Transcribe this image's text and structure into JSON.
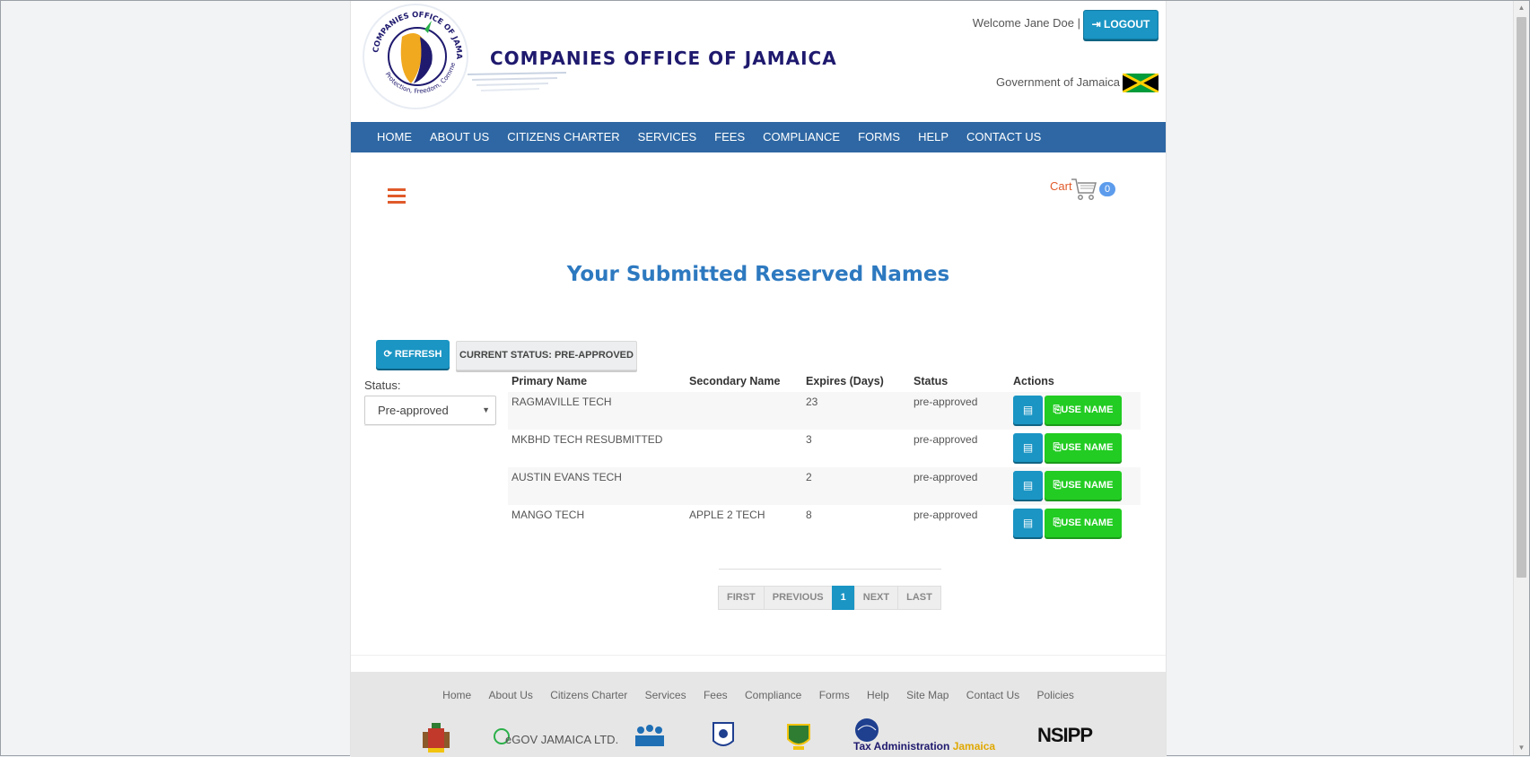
{
  "header": {
    "brand_name": "COMPANIES OFFICE OF JAMAICA",
    "seal_text_top": "COMPANIES OFFICE OF JAMAICA",
    "seal_text_bottom": "Protection, Freedom, Commerce",
    "welcome": "Welcome Jane Doe |",
    "logout_label": "LOGOUT",
    "government_label": "Government of Jamaica"
  },
  "nav": {
    "items": [
      "HOME",
      "ABOUT US",
      "CITIZENS CHARTER",
      "SERVICES",
      "FEES",
      "COMPLIANCE",
      "FORMS",
      "HELP",
      "CONTACT US"
    ]
  },
  "cart": {
    "label": "Cart",
    "count": "0"
  },
  "main": {
    "title": "Your Submitted Reserved Names",
    "refresh_label": "REFRESH",
    "current_status_label": "CURRENT STATUS: PRE-APPROVED",
    "filter_label": "Status:",
    "filter_value": "Pre-approved"
  },
  "table": {
    "headers": [
      "Primary Name",
      "Secondary Name",
      "Expires (Days)",
      "Status",
      "Actions"
    ],
    "rows": [
      {
        "primary": "RAGMAVILLE TECH",
        "secondary": "",
        "expires": "23",
        "status": "pre-approved",
        "use_label": "USE NAME"
      },
      {
        "primary": "MKBHD TECH RESUBMITTED",
        "secondary": "",
        "expires": "3",
        "status": "pre-approved",
        "use_label": "USE NAME"
      },
      {
        "primary": "AUSTIN EVANS TECH",
        "secondary": "",
        "expires": "2",
        "status": "pre-approved",
        "use_label": "USE NAME"
      },
      {
        "primary": "MANGO TECH",
        "secondary": "APPLE 2 TECH",
        "expires": "8",
        "status": "pre-approved",
        "use_label": "USE NAME"
      }
    ]
  },
  "pagination": {
    "first": "FIRST",
    "previous": "PREVIOUS",
    "current": "1",
    "next": "NEXT",
    "last": "LAST"
  },
  "footer": {
    "links": [
      "Home",
      "About Us",
      "Citizens Charter",
      "Services",
      "Fees",
      "Compliance",
      "Forms",
      "Help",
      "Site Map",
      "Contact Us",
      "Policies"
    ],
    "partners": {
      "egov": "eGOV JAMAICA LTD.",
      "tax": "Tax Administration",
      "tax_suffix": "Jamaica",
      "nsipp": "NSIPP"
    }
  },
  "colors": {
    "nav_bg": "#2e67a3",
    "primary_button": "#1a95c4",
    "use_button": "#22cc22",
    "title": "#2d79c0",
    "accent_orange": "#e05a2a"
  }
}
